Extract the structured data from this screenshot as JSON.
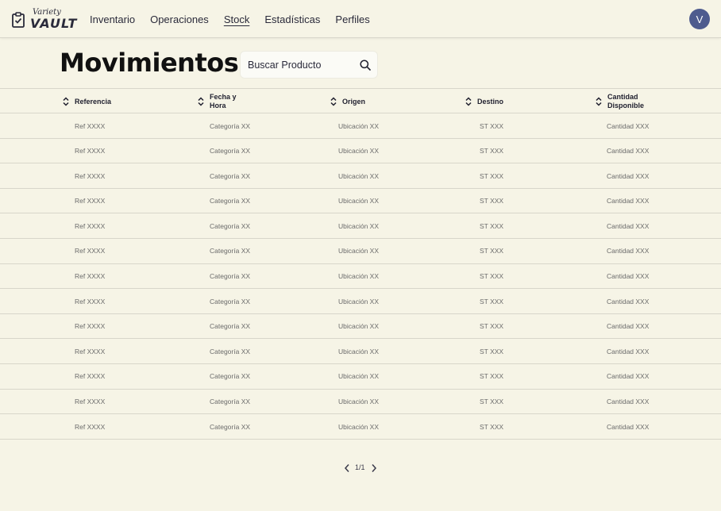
{
  "header": {
    "logo_small": "Variety",
    "logo_big": "VAULT",
    "nav": [
      {
        "label": "Inventario",
        "active": false
      },
      {
        "label": "Operaciones",
        "active": false
      },
      {
        "label": "Stock",
        "active": true
      },
      {
        "label": "Estadísticas",
        "active": false
      },
      {
        "label": "Perfiles",
        "active": false
      }
    ],
    "avatar_initial": "V",
    "avatar_color": "#4e5b8e"
  },
  "main": {
    "title": "Movimientos",
    "search": {
      "placeholder": "Buscar Producto",
      "value": ""
    }
  },
  "table": {
    "columns": [
      {
        "label": "Referencia"
      },
      {
        "label": "Fecha y\nHora"
      },
      {
        "label": "Origen"
      },
      {
        "label": "Destino"
      },
      {
        "label": "Cantidad\nDisponible"
      }
    ],
    "rows": [
      [
        "Ref XXXX",
        "Categoría XX",
        "Ubicación XX",
        "ST XXX",
        "Cantidad XXX"
      ],
      [
        "Ref XXXX",
        "Categoría XX",
        "Ubicación XX",
        "ST XXX",
        "Cantidad XXX"
      ],
      [
        "Ref XXXX",
        "Categoría XX",
        "Ubicación XX",
        "ST XXX",
        "Cantidad XXX"
      ],
      [
        "Ref XXXX",
        "Categoría XX",
        "Ubicación XX",
        "ST XXX",
        "Cantidad XXX"
      ],
      [
        "Ref XXXX",
        "Categoría XX",
        "Ubicación XX",
        "ST XXX",
        "Cantidad XXX"
      ],
      [
        "Ref XXXX",
        "Categoría XX",
        "Ubicación XX",
        "ST XXX",
        "Cantidad XXX"
      ],
      [
        "Ref XXXX",
        "Categoría XX",
        "Ubicación XX",
        "ST XXX",
        "Cantidad XXX"
      ],
      [
        "Ref XXXX",
        "Categoría XX",
        "Ubicación XX",
        "ST XXX",
        "Cantidad XXX"
      ],
      [
        "Ref XXXX",
        "Categoría XX",
        "Ubicación XX",
        "ST XXX",
        "Cantidad XXX"
      ],
      [
        "Ref XXXX",
        "Categoría XX",
        "Ubicación XX",
        "ST XXX",
        "Cantidad XXX"
      ],
      [
        "Ref XXXX",
        "Categoría XX",
        "Ubicación XX",
        "ST XXX",
        "Cantidad XXX"
      ],
      [
        "Ref XXXX",
        "Categoría XX",
        "Ubicación XX",
        "ST XXX",
        "Cantidad XXX"
      ],
      [
        "Ref XXXX",
        "Categoría XX",
        "Ubicación XX",
        "ST XXX",
        "Cantidad XXX"
      ]
    ]
  },
  "pagination": {
    "text": "1/1"
  },
  "icons": {
    "logo": "clipboard-check-icon",
    "search": "search-icon",
    "sort": "sort-icon",
    "prev": "chevron-left-icon",
    "next": "chevron-right-icon"
  },
  "colors": {
    "background": "#f6f4e6",
    "accent": "#4e5b8e",
    "divider": "#d8d6ca"
  }
}
